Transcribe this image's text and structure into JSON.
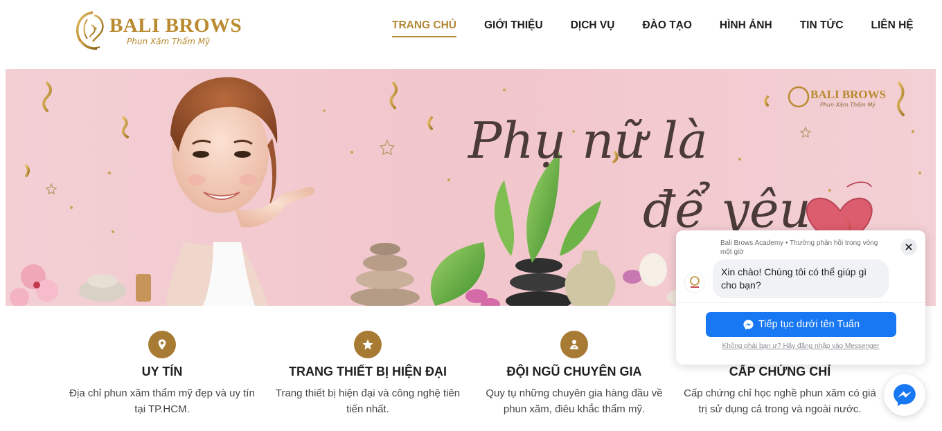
{
  "header": {
    "logo": {
      "title": "BALI BROWS",
      "subtitle": "Phun Xăm Thẩm Mỹ"
    },
    "nav": [
      {
        "label": "TRANG CHỦ",
        "active": true
      },
      {
        "label": "GIỚI THIỆU",
        "active": false
      },
      {
        "label": "DỊCH VỤ",
        "active": false
      },
      {
        "label": "ĐÀO TẠO",
        "active": false
      },
      {
        "label": "HÌNH ẢNH",
        "active": false
      },
      {
        "label": "TIN TỨC",
        "active": false
      },
      {
        "label": "LIÊN HỆ",
        "active": false
      }
    ]
  },
  "banner": {
    "headline_line1": "Phụ nữ là",
    "headline_line2": "để yêu",
    "logo_title": "BALI BROWS",
    "logo_subtitle": "Phun Xăm Thẩm Mỹ"
  },
  "features": [
    {
      "icon": "map-pin-icon",
      "title": "UY TÍN",
      "desc": "Địa chỉ phun xăm thẩm mỹ đẹp và uy tín tại TP.HCM."
    },
    {
      "icon": "star-icon",
      "title": "TRANG THIẾT BỊ HIỆN ĐẠI",
      "desc": "Trang thiết bị hiện đại và công nghệ tiên tiến nhất."
    },
    {
      "icon": "user-doctor-icon",
      "title": "ĐỘI NGŨ CHUYÊN GIA",
      "desc": "Quy tụ những chuyên gia hàng đầu về phun xăm, điêu khắc thẩm mỹ."
    },
    {
      "icon": "certificate-icon",
      "title": "CẤP CHỨNG CHỈ",
      "desc": "Cấp chứng chỉ học nghề phun xăm có giá trị sử dụng cả trong và ngoài nước."
    }
  ],
  "chat": {
    "page_line": "Bali Brows Academy • Thường phản hồi trong vòng một giờ",
    "greeting": "Xin chào! Chúng tôi có thể giúp gì cho bạn?",
    "continue_label": "Tiếp tục dưới tên Tuấn",
    "alt_login": "Không phải bạn ư? Hãy đăng nhập vào Messenger"
  },
  "colors": {
    "gold": "#b38836",
    "icon_bg": "#a87b35",
    "messenger_blue": "#1877f2",
    "banner_pink": "#f2c9cf"
  }
}
